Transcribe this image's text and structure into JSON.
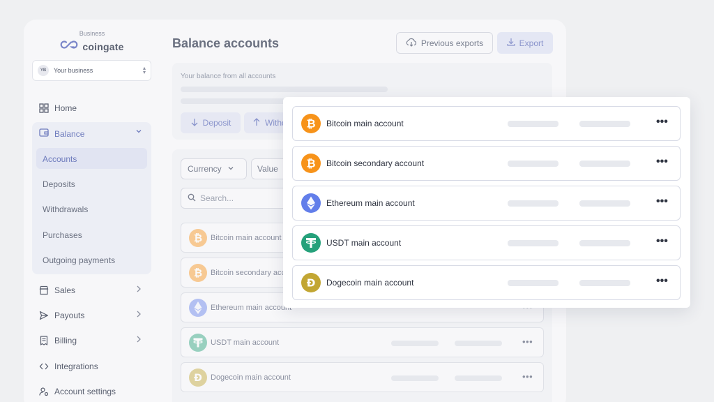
{
  "brand": {
    "sub": "Business",
    "name": "coingate"
  },
  "business": {
    "avatar": "YB",
    "name": "Your business",
    "caret_up": "▴",
    "caret_down": "▾"
  },
  "nav": {
    "home": "Home",
    "balance": "Balance",
    "balance_sub": [
      "Accounts",
      "Deposits",
      "Withdrawals",
      "Purchases",
      "Outgoing payments"
    ],
    "sales": "Sales",
    "payouts": "Payouts",
    "billing": "Billing",
    "integrations": "Integrations",
    "account_settings": "Account settings"
  },
  "header": {
    "title": "Balance accounts",
    "previous_exports": "Previous exports",
    "export": "Export"
  },
  "summary": {
    "label": "Your balance from all accounts",
    "deposit": "Deposit",
    "withdraw": "Withd"
  },
  "filters": {
    "currency": "Currency",
    "value": "Value",
    "search_placeholder": "Search..."
  },
  "accounts": [
    {
      "name": "Bitcoin main account",
      "coin": "bitcoin-icon",
      "color": "#f7931a",
      "more": "•••"
    },
    {
      "name": "Bitcoin secondary account",
      "coin": "bitcoin-icon",
      "color": "#f7931a",
      "more": "•••"
    },
    {
      "name": "Ethereum main account",
      "coin": "ethereum-icon",
      "color": "#627eea",
      "more": "•••"
    },
    {
      "name": "USDT main account",
      "coin": "tether-icon",
      "color": "#26a17b",
      "more": "•••"
    },
    {
      "name": "Dogecoin main account",
      "coin": "dogecoin-icon",
      "color": "#c2a633",
      "more": "•••"
    }
  ],
  "bg_accounts": [
    {
      "name": "Bitcoin main account",
      "more": "•••"
    },
    {
      "name": "Bitcoin secondary acc",
      "more": "•••"
    },
    {
      "name": "Ethereum main account",
      "more": "•••"
    },
    {
      "name": "USDT main account",
      "more": "•••"
    },
    {
      "name": "Dogecoin main account",
      "more": "•••"
    }
  ],
  "colors": {
    "accent": "#6e7bbd",
    "background": "#eff0f2"
  }
}
